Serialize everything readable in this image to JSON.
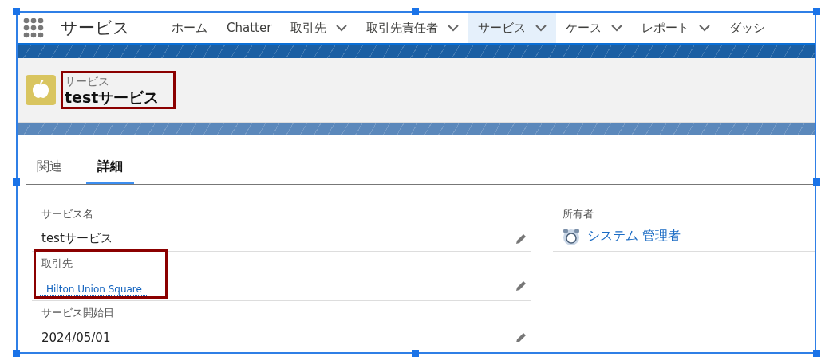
{
  "app_name": "サービス",
  "nav": [
    {
      "label": "ホーム",
      "dropdown": false,
      "selected": false
    },
    {
      "label": "Chatter",
      "dropdown": false,
      "selected": false
    },
    {
      "label": "取引先",
      "dropdown": true,
      "selected": false
    },
    {
      "label": "取引先責任者",
      "dropdown": true,
      "selected": false
    },
    {
      "label": "サービス",
      "dropdown": true,
      "selected": true
    },
    {
      "label": "ケース",
      "dropdown": true,
      "selected": false
    },
    {
      "label": "レポート",
      "dropdown": true,
      "selected": false
    },
    {
      "label": "ダッシ",
      "dropdown": false,
      "selected": false
    }
  ],
  "record": {
    "object_type": "サービス",
    "title": "testサービス",
    "highlighted": true
  },
  "tabs": [
    {
      "label": "関連",
      "selected": false
    },
    {
      "label": "詳細",
      "selected": true
    }
  ],
  "left_fields": [
    {
      "label": "サービス名",
      "value": "testサービス",
      "kind": "text",
      "editable": true,
      "highlighted": false
    },
    {
      "label": "取引先",
      "value": "Hilton Union Square",
      "kind": "link",
      "editable": true,
      "highlighted": true
    },
    {
      "label": "サービス開始日",
      "value": "2024/05/01",
      "kind": "text",
      "editable": true,
      "highlighted": false
    }
  ],
  "right_fields": [
    {
      "label": "所有者",
      "value": "システム 管理者",
      "kind": "user",
      "editable": false,
      "highlighted": false
    }
  ]
}
